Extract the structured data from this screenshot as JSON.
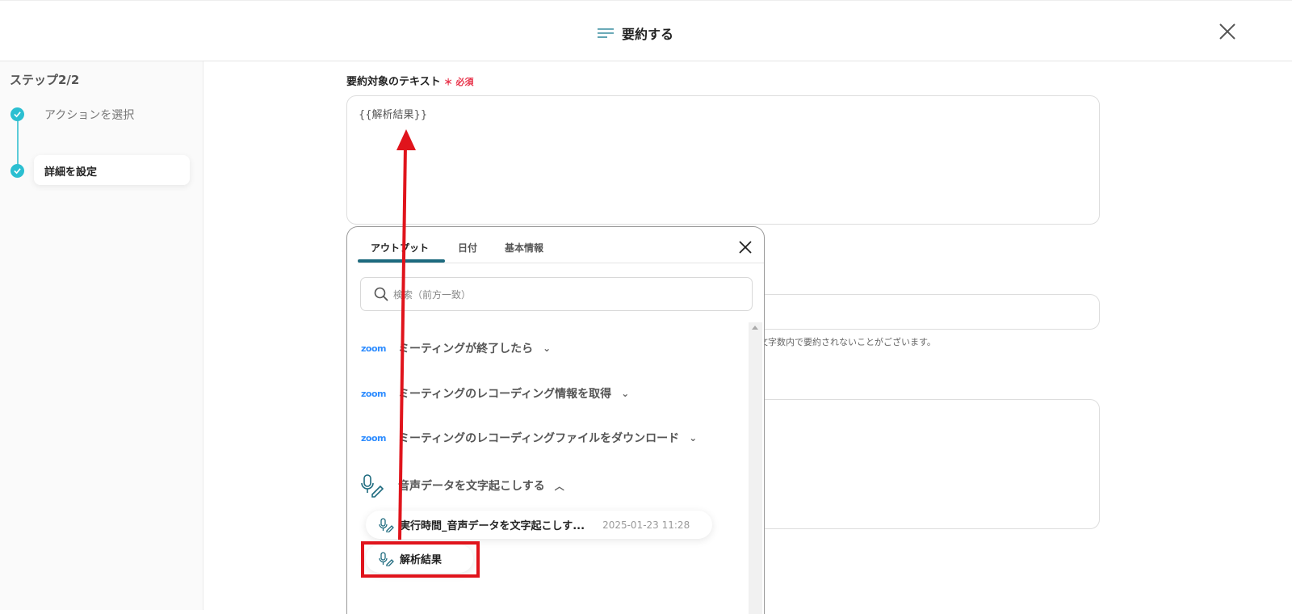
{
  "header": {
    "title": "要約する",
    "icon": "summary-lines-icon"
  },
  "sidebar": {
    "step_label": "ステップ2/2",
    "steps": [
      {
        "label": "アクションを選択",
        "done": true
      },
      {
        "label": "詳細を設定",
        "done": true,
        "active": true
      }
    ]
  },
  "form": {
    "field_label": "要約対象のテキスト",
    "required_mark": "＊",
    "required_label": "必須",
    "field_value": "{{解析結果}}",
    "helper_text": "文字数内で要約されないことがございます。"
  },
  "panel": {
    "tabs": [
      {
        "label": "アウトプット",
        "active": true
      },
      {
        "label": "日付"
      },
      {
        "label": "基本情報"
      }
    ],
    "search_placeholder": "検索（前方一致）",
    "groups": [
      {
        "source": "zoom",
        "label": "ミーティングが終了したら",
        "expanded": false
      },
      {
        "source": "zoom",
        "label": "ミーティングのレコーディング情報を取得",
        "expanded": false
      },
      {
        "source": "zoom",
        "label": "ミーティングのレコーディングファイルをダウンロード",
        "expanded": false
      },
      {
        "source": "transcribe",
        "label": "音声データを文字起こしする",
        "expanded": true
      }
    ],
    "outputs": [
      {
        "label": "実行時間_音声データを文字起こしす...",
        "timestamp": "2025-01-23 11:28"
      },
      {
        "label": "解析結果",
        "highlighted": true
      }
    ]
  },
  "colors": {
    "accent": "#2bbfd1",
    "tab_underline": "#1d6a7e",
    "annotation": "#e0141c",
    "required": "#e8334a",
    "zoom_brand": "#2d8cff"
  }
}
